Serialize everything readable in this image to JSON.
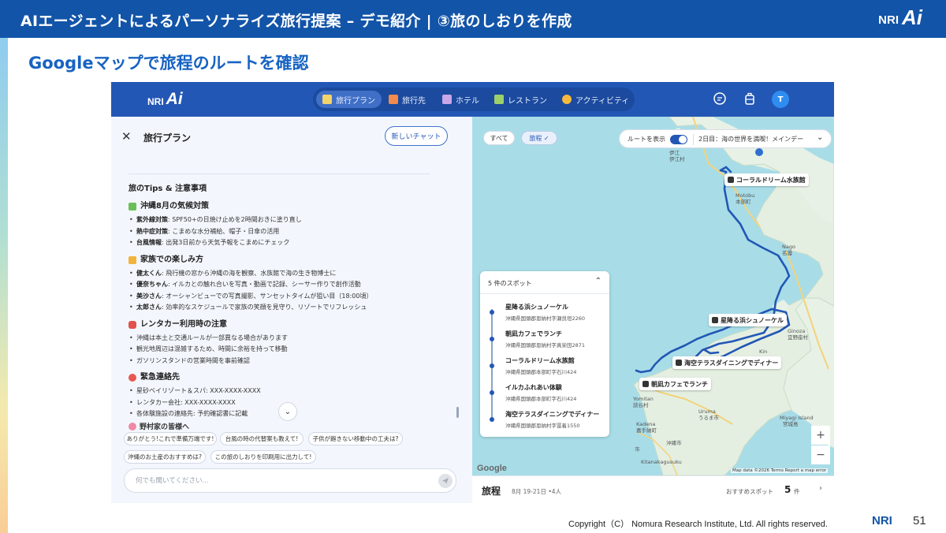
{
  "slide": {
    "title": "AIエージェントによるパーソナライズ旅行提案 – デモ紹介 | ③旅のしおりを作成",
    "subtitle": "Googleマップで旅程のルートを確認",
    "logo_nri": "NRI",
    "logo_ai": "Ai",
    "copyright": "Copyright（C） Nomura Research Institute, Ltd. All rights reserved.",
    "footer_logo": "NRI",
    "page_number": "51"
  },
  "app": {
    "logo_nri": "NRI",
    "logo_ai": "Ai",
    "nav": [
      {
        "label": "旅行プラン",
        "active": true
      },
      {
        "label": "旅行先"
      },
      {
        "label": "ホテル"
      },
      {
        "label": "レストラン"
      },
      {
        "label": "アクティビティ"
      }
    ],
    "avatar": "T"
  },
  "chat": {
    "title": "旅行プラン",
    "new_chat": "新しいチャット",
    "tips_title": "旅のTips & 注意事項",
    "weather": {
      "title": "沖縄8月の気候対策",
      "items": [
        {
          "k": "紫外線対策",
          "v": ": SPF50+の日焼け止めを2時間おきに塗り直し"
        },
        {
          "k": "熱中症対策",
          "v": ": こまめな水分補給、帽子・日傘の活用"
        },
        {
          "k": "台風情報",
          "v": ": 出発3日前から天気予報をこまめにチェック"
        }
      ]
    },
    "family": {
      "title": "家族での楽しみ方",
      "items": [
        {
          "k": "健太くん",
          "v": ": 飛行機の窓から沖縄の海を観察、水族館で海の生き物博士に"
        },
        {
          "k": "優奈ちゃん",
          "v": ": イルカとの触れ合いを写真・動画で記録、シーサー作りで創作活動"
        },
        {
          "k": "美沙さん",
          "v": ": オーシャンビューでの写真撮影、サンセットタイムが狙い目（18:00頃）"
        },
        {
          "k": "太郎さん",
          "v": ": 効率的なスケジュールで家族の笑顔を見守り、リゾートでリフレッシュ"
        }
      ]
    },
    "rental": {
      "title": "レンタカー利用時の注意",
      "items": [
        "沖縄は本土と交通ルールが一部異なる場合があります",
        "観光地周辺は混雑するため、時間に余裕を持って移動",
        "ガソリンスタンドの営業時間を事前確認"
      ]
    },
    "emergency": {
      "title": "緊急連絡先",
      "items": [
        "星砂ベイリゾート＆スパ: XXX-XXXX-XXXX",
        "レンタカー会社: XXX-XXXX-XXXX",
        "各体験施設の連絡先: 予約確認書に記載"
      ]
    },
    "to_family": "野村家の皆様へ",
    "suggestions": [
      "ありがとう!これで準備万端です!",
      "台風の時の代替案も教えて!",
      "子供が飽きない移動中の工夫は?",
      "沖縄のお土産のおすすめは?",
      "この旅のしおりを印刷用に出力して!"
    ],
    "input_placeholder": "何でも聞いてください..."
  },
  "map": {
    "filter_all": "すべて",
    "filter_trip": "旅程 ✓",
    "route_label": "ルートを表示",
    "day_label": "2日目：海の世界を満喫！メインデー",
    "spots_header": "5 件のスポット",
    "spots": [
      {
        "name": "星降る浜シュノーケル",
        "address": "沖縄県国頭郡恩納村字瀬良垣2260"
      },
      {
        "name": "朝凪カフェでランチ",
        "address": "沖縄県国頭郡恩納村字真栄田2871"
      },
      {
        "name": "コーラルドリーム水族館",
        "address": "沖縄県国頭郡本部町字石川424"
      },
      {
        "name": "イルカふれあい体験",
        "address": "沖縄県国頭郡本部町字石川424"
      },
      {
        "name": "海空テラスダイニングでディナー",
        "address": "沖縄県国頭郡恩納村字冨着1550"
      }
    ],
    "labels": {
      "aquarium": "コーラルドリーム水族館",
      "snorkel": "星降る浜シュノーケル",
      "dinner": "海空テラスダイニングでディナー",
      "lunch": "朝凪カフェでランチ"
    },
    "places": {
      "ie": "伊江村",
      "motobu": "Motobu",
      "motobu_jp": "本部町",
      "nago": "Nago",
      "nago_jp": "名護",
      "ginoza": "Ginoza",
      "ginoza_jp": "宜野座村",
      "kin": "Kin",
      "yomitan": "Yomitan",
      "yomitan_jp": "読谷村",
      "kadena": "Kadena",
      "kadena_jp": "嘉手納町",
      "uruma": "Uruma",
      "uruma_jp": "うるま市",
      "okinawa_jp": "沖縄市",
      "miyagi": "Miyagi Island",
      "miyagi_jp": "宮城島",
      "kitanakagusuku": "Kitanakagusuku",
      "shi": "市",
      "ie_top": "伊江"
    },
    "zoom_in": "+",
    "zoom_out": "−",
    "google": "Google",
    "attribution": "Map data ©2026   Terms   Report a map error"
  },
  "trip_footer": {
    "title": "旅程",
    "dates": "8月 19-21日 •4人",
    "recommended": "おすすめスポット",
    "count": "5",
    "unit": "件",
    "chevron": "›"
  },
  "colors": {
    "brand": "#1254a8",
    "header": "#2357b5",
    "route": "#2357b5",
    "land": "#e8f1e6",
    "sea": "#a8dde8"
  }
}
